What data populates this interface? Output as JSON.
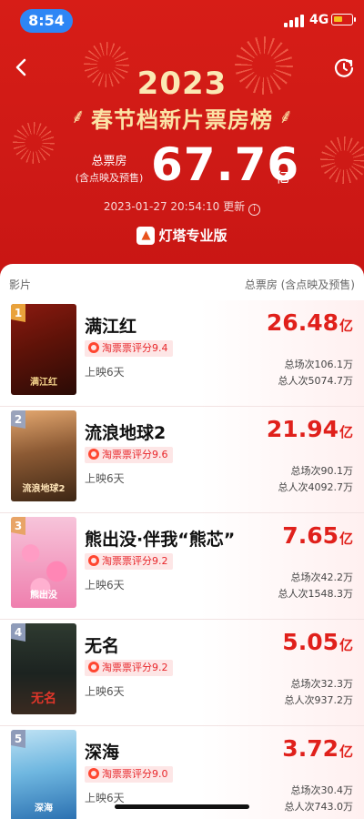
{
  "status_bar": {
    "time": "8:54",
    "network": "4G"
  },
  "header": {
    "year": "2023",
    "title": "春节档新片票房榜",
    "total_label": "总票房",
    "total_sublabel": "(含点映及预售)",
    "total_value": "67.76",
    "total_unit": "亿",
    "update_time": "2023-01-27 20:54:10 更新",
    "brand": "灯塔专业版"
  },
  "list_header": {
    "left": "影片",
    "right": "总票房 (含点映及预售)"
  },
  "movies": [
    {
      "rank": "1",
      "title": "满江红",
      "rating": "淘票票评分9.4",
      "days": "上映6天",
      "gross": "26.48",
      "unit": "亿",
      "sessions": "总场次106.1万",
      "viewers": "总人次5074.7万",
      "poster_text": "满江红"
    },
    {
      "rank": "2",
      "title": "流浪地球2",
      "rating": "淘票票评分9.6",
      "days": "上映6天",
      "gross": "21.94",
      "unit": "亿",
      "sessions": "总场次90.1万",
      "viewers": "总人次4092.7万",
      "poster_text": "流浪地球2"
    },
    {
      "rank": "3",
      "title": "熊出没·伴我“熊芯”",
      "rating": "淘票票评分9.2",
      "days": "上映6天",
      "gross": "7.65",
      "unit": "亿",
      "sessions": "总场次42.2万",
      "viewers": "总人次1548.3万",
      "poster_text": "熊出没"
    },
    {
      "rank": "4",
      "title": "无名",
      "rating": "淘票票评分9.2",
      "days": "上映6天",
      "gross": "5.05",
      "unit": "亿",
      "sessions": "总场次32.3万",
      "viewers": "总人次937.2万",
      "poster_text": "无名"
    },
    {
      "rank": "5",
      "title": "深海",
      "rating": "淘票票评分9.0",
      "days": "上映6天",
      "gross": "3.72",
      "unit": "亿",
      "sessions": "总场次30.4万",
      "viewers": "总人次743.0万",
      "poster_text": "深海"
    }
  ],
  "colors": {
    "header_red": "#d71d17",
    "accent_gold": "#fbe3a6",
    "gross_red": "#e0201b",
    "rank_gold": "#e9a23b",
    "rank_silver": "#9aa3bb",
    "rank_bronze": "#e8a467",
    "rank_default": "#8e9bb9"
  }
}
